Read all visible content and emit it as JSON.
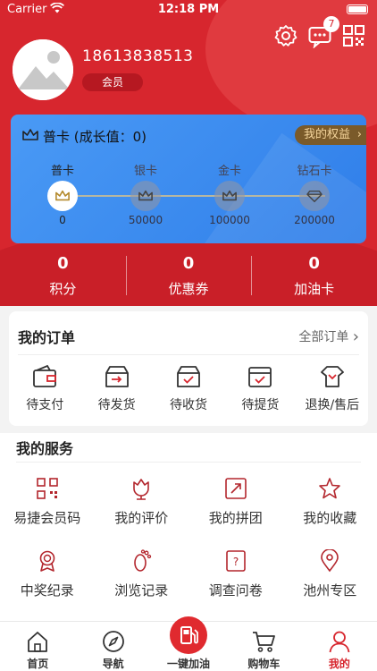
{
  "status_bar": {
    "carrier": "Carrier",
    "time": "12:18 PM"
  },
  "header": {
    "message_badge": "7",
    "phone": "18613838513",
    "member_label": "会员"
  },
  "level_card": {
    "title": "普卡 (成长值：0)",
    "rights_label": "我的权益",
    "tiers": [
      {
        "name": "普卡",
        "threshold": "0"
      },
      {
        "name": "银卡",
        "threshold": "50000"
      },
      {
        "name": "金卡",
        "threshold": "100000"
      },
      {
        "name": "钻石卡",
        "threshold": "200000"
      }
    ]
  },
  "stats": [
    {
      "value": "0",
      "label": "积分"
    },
    {
      "value": "0",
      "label": "优惠券"
    },
    {
      "value": "0",
      "label": "加油卡"
    }
  ],
  "orders": {
    "title": "我的订单",
    "all_label": "全部订单",
    "items": [
      "待支付",
      "待发货",
      "待收货",
      "待提货",
      "退换/售后"
    ]
  },
  "services": {
    "title": "我的服务",
    "items": [
      "易捷会员码",
      "我的评价",
      "我的拼团",
      "我的收藏",
      "中奖纪录",
      "浏览记录",
      "调查问卷",
      "池州专区"
    ]
  },
  "tabbar": [
    "首页",
    "导航",
    "一键加油",
    "购物车",
    "我的"
  ],
  "colors": {
    "brand_red": "#d7262e",
    "card_blue": "#3f8ff0",
    "rights_gold": "#f5d59c"
  }
}
